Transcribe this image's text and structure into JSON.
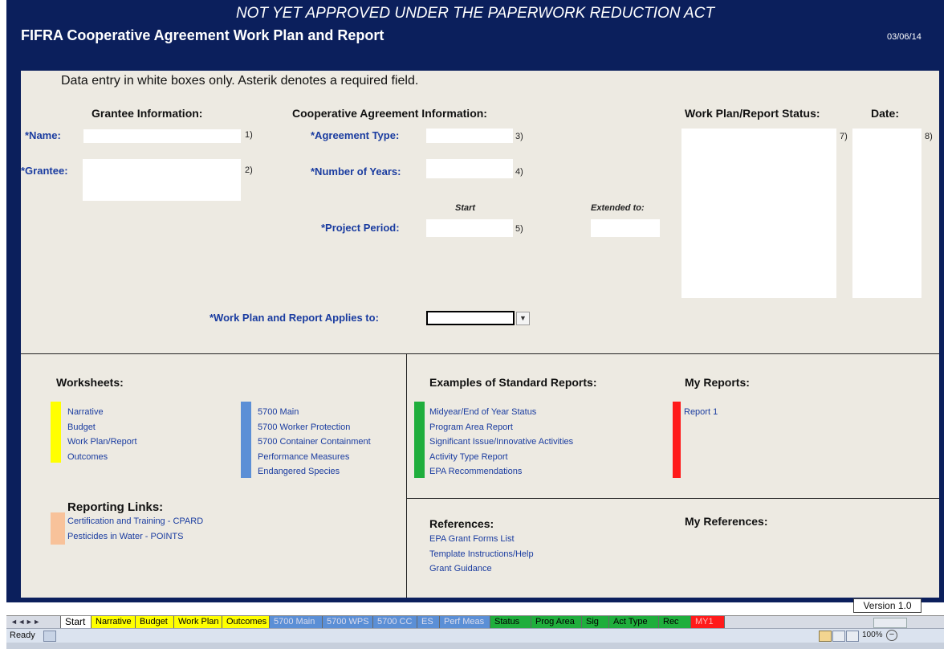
{
  "header": {
    "notice": "NOT YET APPROVED UNDER THE PAPERWORK REDUCTION ACT",
    "title": "FIFRA Cooperative Agreement Work Plan and Report",
    "date": "03/06/14",
    "background_color": "#0b1f5c"
  },
  "instruction": "Data entry in white boxes only. Asterik denotes a required field.",
  "grantee": {
    "heading": "Grantee Information:",
    "name_label": "*Name:",
    "name_num": "1)",
    "grantee_label": "*Grantee:",
    "grantee_num": "2)"
  },
  "coop": {
    "heading": "Cooperative Agreement Information:",
    "agreement_type_label": "*Agreement Type:",
    "agreement_type_num": "3)",
    "years_label": "*Number of Years:",
    "years_num": "4)",
    "start_label": "Start",
    "extended_label": "Extended to:",
    "project_period_label": "*Project Period:",
    "project_period_num": "5)"
  },
  "status": {
    "heading": "Work Plan/Report Status:",
    "num": "7)",
    "date_heading": "Date:",
    "date_num": "8)"
  },
  "applies_label": "*Work Plan and Report Applies to:",
  "worksheets": {
    "heading": "Worksheets:",
    "group1_color": "#ffff00",
    "group1": [
      "Narrative",
      "Budget",
      "Work Plan/Report",
      "Outcomes"
    ],
    "group2_color": "#5b8fd6",
    "group2": [
      "5700 Main",
      "5700 Worker Protection",
      "5700 Container Containment",
      "Performance Measures",
      "Endangered Species"
    ]
  },
  "reporting_links": {
    "heading": "Reporting Links:",
    "color": "#f8c29a",
    "items": [
      "Certification and Training - CPARD",
      "Pesticides in Water - POINTS"
    ]
  },
  "standard_reports": {
    "heading": "Examples of Standard Reports:",
    "color": "#1fae3c",
    "items": [
      "Midyear/End of Year Status",
      "Program Area Report",
      "Significant Issue/Innovative Activities",
      "Activity Type Report",
      "EPA Recommendations"
    ]
  },
  "my_reports": {
    "heading": "My Reports:",
    "color": "#ff1a1a",
    "items": [
      "Report 1"
    ]
  },
  "references": {
    "heading": "References:",
    "items": [
      "EPA Grant Forms List",
      "Template Instructions/Help",
      "Grant Guidance"
    ]
  },
  "my_references": {
    "heading": "My References:"
  },
  "version": "Version 1.0",
  "tabs": {
    "nav": "◄ ◄ ► ►",
    "start": "Start",
    "narrative": "Narrative",
    "budget": "Budget",
    "work_plan": "Work Plan",
    "outcomes": "Outcomes",
    "main5700": "5700 Main",
    "wps5700": "5700 WPS",
    "cc5700": "5700 CC",
    "es": "ES",
    "perf_meas": "Perf Meas",
    "status": "Status",
    "prog_area": "Prog Area",
    "sig": "Sig",
    "act_type": "Act Type",
    "rec": "Rec",
    "my1": "MY1"
  },
  "statusbar": {
    "ready": "Ready",
    "zoom": "100%"
  }
}
